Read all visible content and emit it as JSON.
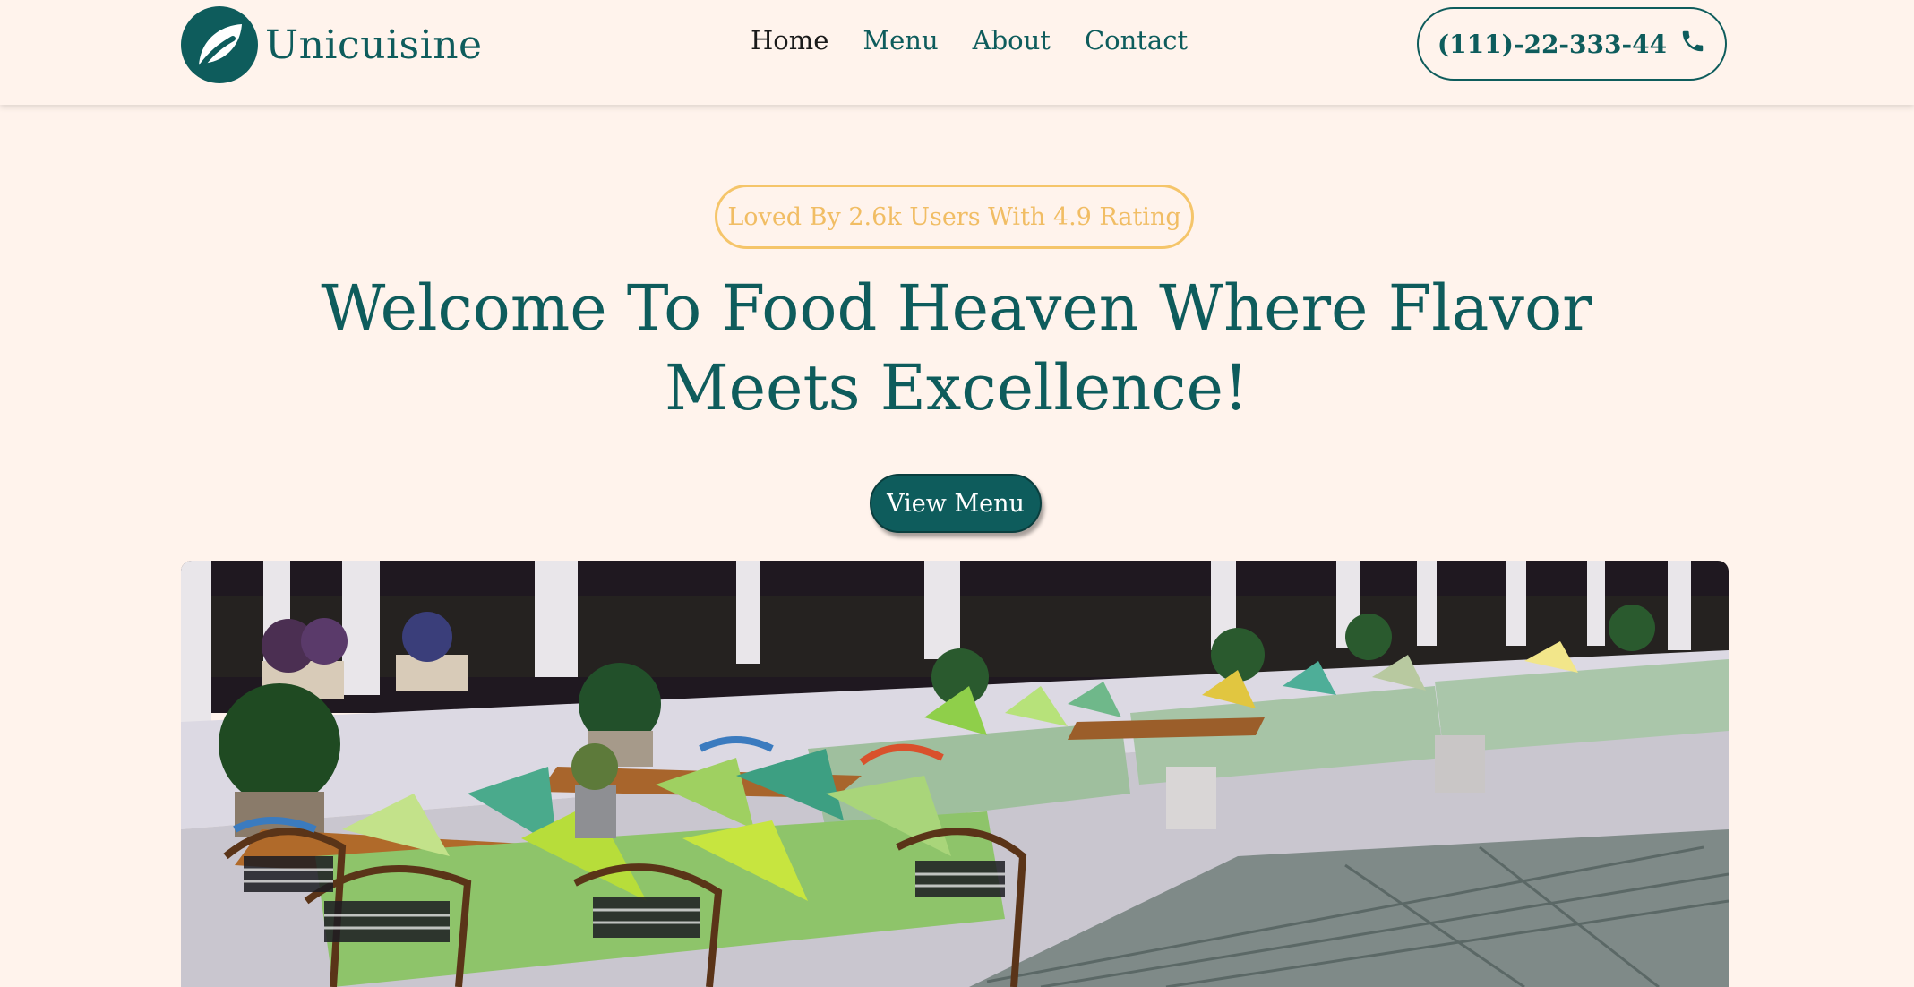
{
  "brand": {
    "name": "Unicuisine",
    "logo_icon": "leaf-icon",
    "color": "#0e5c5c"
  },
  "nav": {
    "items": [
      {
        "label": "Home",
        "active": true
      },
      {
        "label": "Menu",
        "active": false
      },
      {
        "label": "About",
        "active": false
      },
      {
        "label": "Contact",
        "active": false
      }
    ]
  },
  "phone": {
    "number": "(111)-22-333-44",
    "icon": "phone-icon"
  },
  "hero": {
    "badge": "Loved By 2.6k Users With 4.9 Rating",
    "headline": "Welcome To Food Heaven Where Flavor Meets Excellence!",
    "cta_label": "View Menu"
  },
  "colors": {
    "background": "#fff3ec",
    "accent": "#0e5c5c",
    "badge": "#f1bd64"
  }
}
